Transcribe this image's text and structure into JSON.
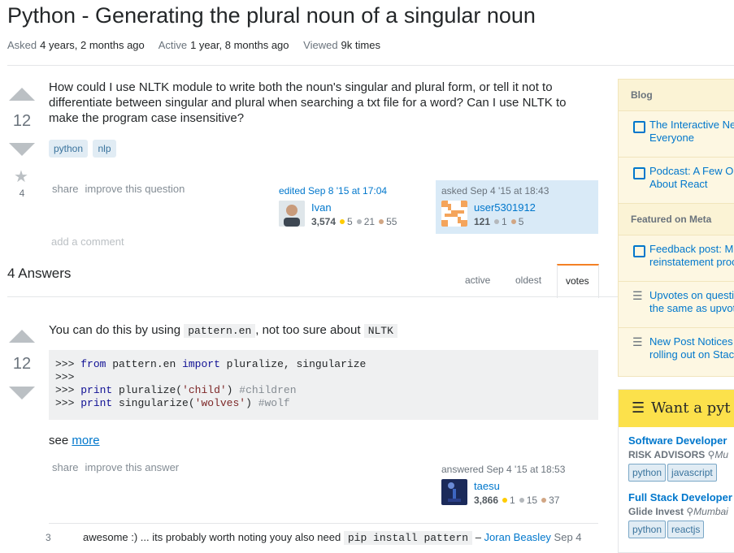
{
  "question": {
    "title": "Python - Generating the plural noun of a singular noun",
    "meta": {
      "asked_label": "Asked",
      "asked_value": "4 years, 2 months ago",
      "active_label": "Active",
      "active_value": "1 year, 8 months ago",
      "viewed_label": "Viewed",
      "viewed_value": "9k times"
    },
    "score": "12",
    "favorites": "4",
    "body": "How could I use NLTK module to write both the noun's singular and plural form, or tell it not to differentiate between singular and plural when searching a txt file for a word? Can I use NLTK to make the program case insensitive?",
    "tags": [
      "python",
      "nlp"
    ],
    "menu": {
      "share": "share",
      "improve": "improve this question"
    },
    "edited": {
      "label": "edited Sep 8 '15 at 17:04",
      "user": "Ivan",
      "rep": "3,574",
      "gold": "5",
      "silver": "21",
      "bronze": "55"
    },
    "asked": {
      "label": "asked Sep 4 '15 at 18:43",
      "user": "user5301912",
      "rep": "121",
      "silver": "1",
      "bronze": "5"
    },
    "add_comment": "add a comment"
  },
  "answers_header": {
    "count_label": "4 Answers",
    "tabs": [
      "active",
      "oldest",
      "votes"
    ]
  },
  "answer": {
    "score": "12",
    "intro_before": "You can do this by using ",
    "intro_code": "pattern.en",
    "intro_middle": ", not too sure about ",
    "intro_code2": "NLTK",
    "code": {
      "p1": ">>> ",
      "l1a": "from",
      "l1b": " pattern.en ",
      "l1c": "import",
      "l1d": " pluralize, singularize",
      "l2": ">>>",
      "p3": ">>> ",
      "l3a": "print",
      "l3b": " pluralize(",
      "l3c": "'child'",
      "l3d": ") ",
      "l3e": "#children",
      "p4": ">>> ",
      "l4a": "print",
      "l4b": " singularize(",
      "l4c": "'wolves'",
      "l4d": ") ",
      "l4e": "#wolf"
    },
    "see": "see ",
    "see_link": "more",
    "menu": {
      "share": "share",
      "improve": "improve this answer"
    },
    "answered": {
      "label": "answered Sep 4 '15 at 18:53",
      "user": "taesu",
      "rep": "3,866",
      "gold": "1",
      "silver": "15",
      "bronze": "37"
    },
    "comment": {
      "score": "3",
      "text_before": "awesome :) ... its probably worth noting youy also need ",
      "code": "pip install pattern",
      "dash": " – ",
      "user": "Joran Beasley",
      "date": " Sep 4"
    }
  },
  "sidebar": {
    "blog_head": "Blog",
    "blog_items": [
      "The Interactive Ne… Everyone",
      "Podcast: A Few O… About React"
    ],
    "blog_lines": [
      [
        "The Interactive Ne",
        "Everyone"
      ],
      [
        "Podcast: A Few O",
        "About React"
      ]
    ],
    "meta_head": "Featured on Meta",
    "meta_lines": [
      [
        "Feedback post: M",
        "reinstatement proc"
      ],
      [
        "Upvotes on questi",
        "the same as upvot"
      ],
      [
        "New Post Notices",
        "rolling out on Stac"
      ]
    ]
  },
  "jobs": {
    "heading": "Want a pyt",
    "items": [
      {
        "title": "Software Developer",
        "company": "RISK ADVISORS",
        "location": "Mu",
        "tags": [
          "python",
          "javascript"
        ]
      },
      {
        "title": "Full Stack Developer",
        "company": "Glide Invest",
        "location": "Mumbai",
        "tags": [
          "python",
          "reactjs"
        ]
      }
    ]
  },
  "colors": {
    "link": "#0077cc",
    "tag_bg": "#e1ecf4",
    "tag_text": "#39739d",
    "gold": "#ffcc01",
    "silver": "#b4b8bc",
    "bronze": "#d1a684",
    "jobs_bar": "#fce14b",
    "sidebar_bg": "#fdf7e2"
  }
}
